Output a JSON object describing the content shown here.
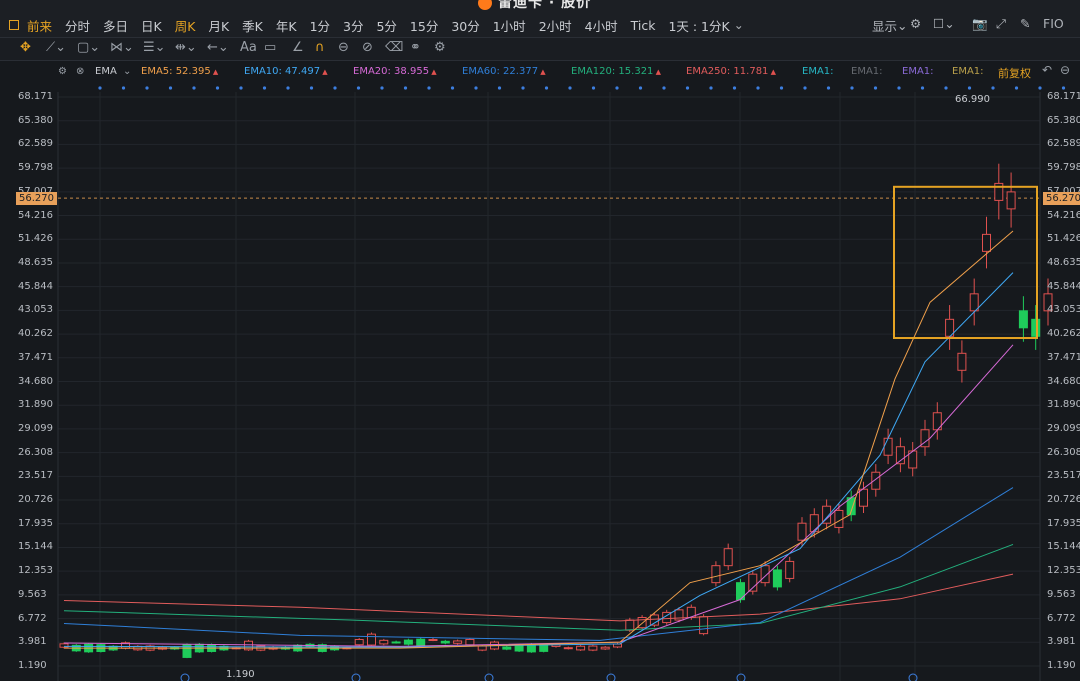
{
  "app": {
    "title": "雷迪卡 · 股价"
  },
  "periods": [
    {
      "label": "前来",
      "active": true
    },
    {
      "label": "分时",
      "active": false
    },
    {
      "label": "多日",
      "active": false
    },
    {
      "label": "日K",
      "active": false
    },
    {
      "label": "周K",
      "active": true
    },
    {
      "label": "月K",
      "active": false
    },
    {
      "label": "季K",
      "active": false
    },
    {
      "label": "年K",
      "active": false
    },
    {
      "label": "1分",
      "active": false
    },
    {
      "label": "3分",
      "active": false
    },
    {
      "label": "5分",
      "active": false
    },
    {
      "label": "15分",
      "active": false
    },
    {
      "label": "30分",
      "active": false
    },
    {
      "label": "1小时",
      "active": false
    },
    {
      "label": "2小时",
      "active": false
    },
    {
      "label": "4小时",
      "active": false
    },
    {
      "label": "Tick",
      "active": false
    },
    {
      "label": "1天 : 1分K",
      "active": false
    }
  ],
  "right_tools": {
    "display_label": "显示",
    "fio_label": "FIO"
  },
  "ema": {
    "name": "EMA",
    "items": [
      {
        "label": "EMA5: 52.395",
        "color": "#f0a04b"
      },
      {
        "label": "EMA10: 47.497",
        "color": "#3fa9f5"
      },
      {
        "label": "EMA20: 38.955",
        "color": "#d66ad6"
      },
      {
        "label": "EMA60: 22.377",
        "color": "#2f7fd8"
      },
      {
        "label": "EMA120: 15.321",
        "color": "#23b07d"
      },
      {
        "label": "EMA250: 11.781",
        "color": "#e15c5c"
      },
      {
        "label": "EMA1:",
        "color": "#27b6c4"
      },
      {
        "label": "EMA1:",
        "color": "#666a70"
      },
      {
        "label": "EMA1:",
        "color": "#8a6ad6"
      },
      {
        "label": "EMA1:",
        "color": "#b9a04b"
      }
    ],
    "adjust_label": "前复权"
  },
  "price_axis": [
    "68.171",
    "65.380",
    "62.589",
    "59.798",
    "57.007",
    "54.216",
    "51.426",
    "48.635",
    "45.844",
    "43.053",
    "40.262",
    "37.471",
    "34.680",
    "31.890",
    "29.099",
    "26.308",
    "23.517",
    "20.726",
    "17.935",
    "15.144",
    "12.353",
    "9.563",
    "6.772",
    "3.981",
    "1.190"
  ],
  "current_price": "56.270",
  "high_label": "66.990",
  "low_label": "1.190",
  "colors": {
    "up": "#e0514f",
    "down": "#1fcc5b",
    "highlight": "#e5a323",
    "bg": "#16191d"
  }
}
